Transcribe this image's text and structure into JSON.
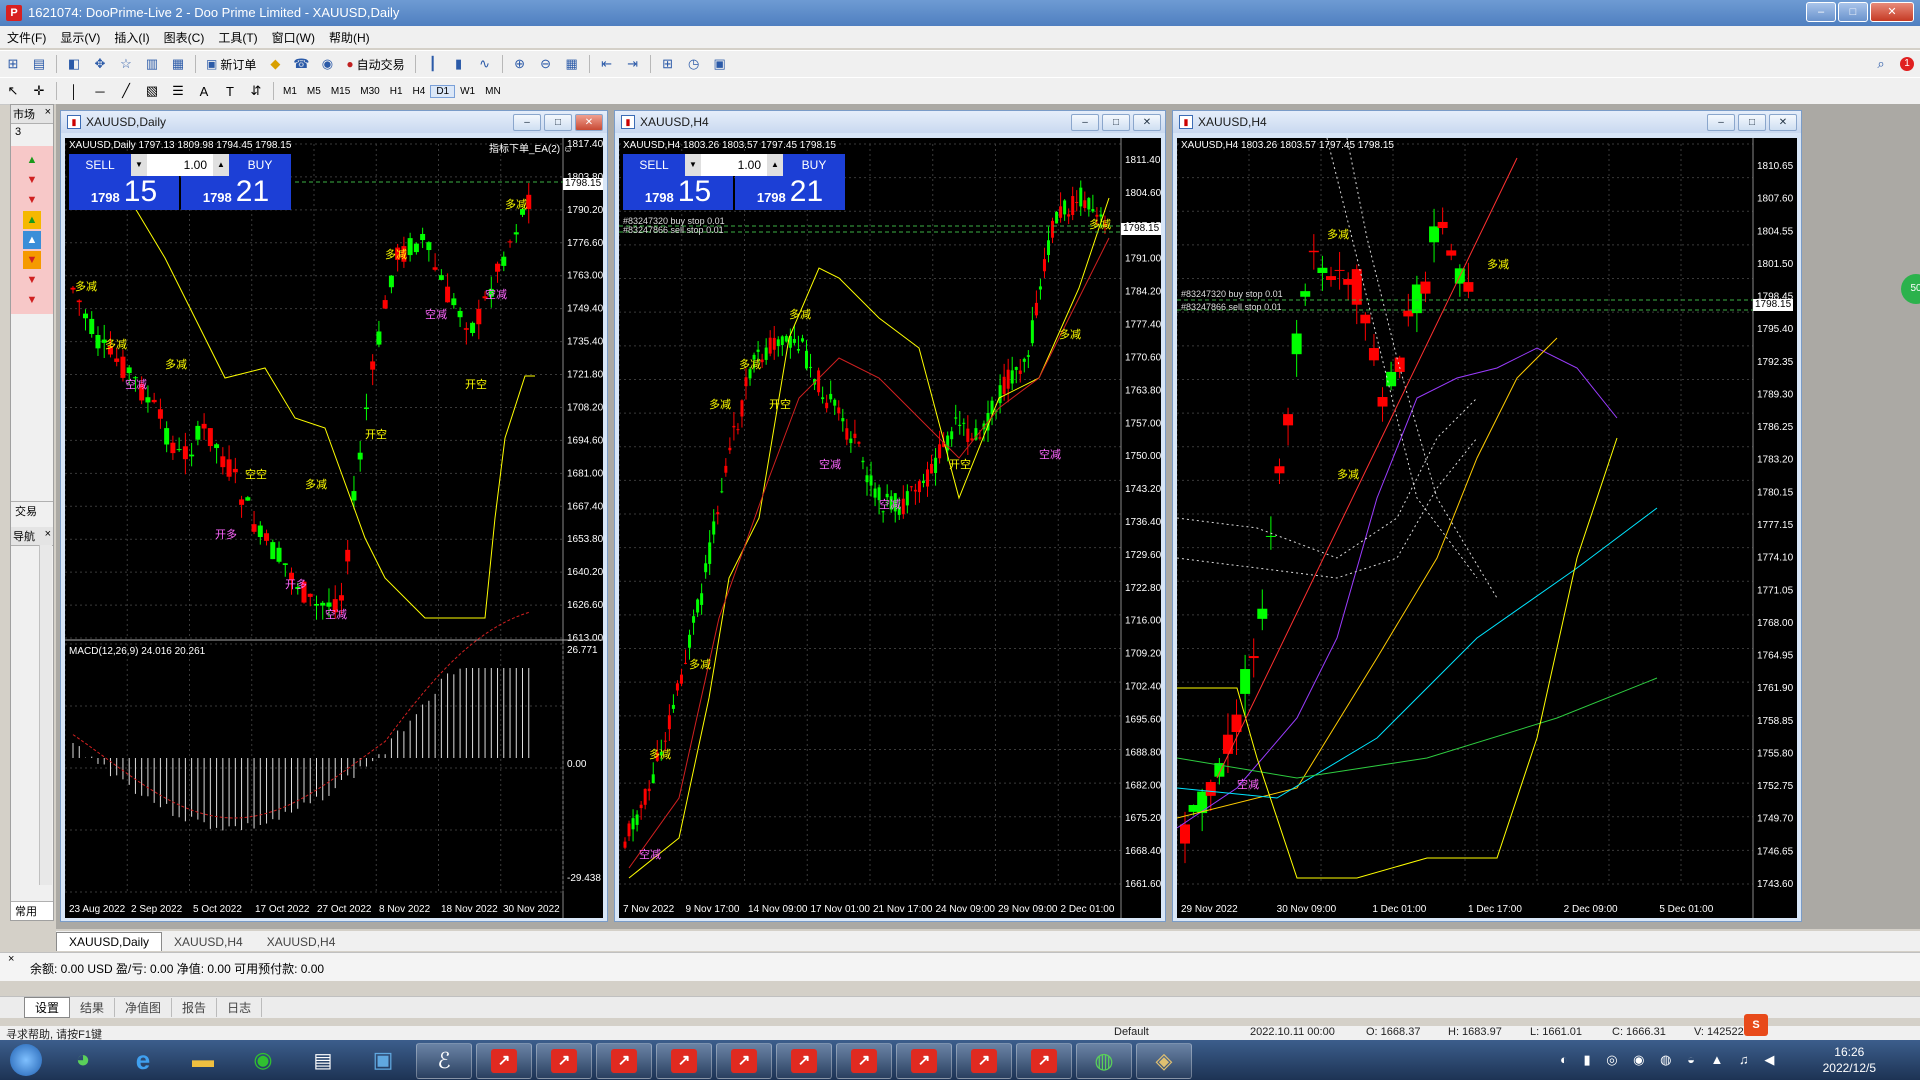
{
  "window": {
    "title": "1621074: DooPrime-Live 2 - Doo Prime Limited - XAUUSD,Daily",
    "logo": "P",
    "minimize": "–",
    "maximize": "□",
    "close": "✕"
  },
  "menu": [
    "文件(F)",
    "显示(V)",
    "插入(I)",
    "图表(C)",
    "工具(T)",
    "窗口(W)",
    "帮助(H)"
  ],
  "toolbar": {
    "new_order": "新订单",
    "auto_trade": "自动交易",
    "notification_count": "1"
  },
  "timeframes": [
    "M1",
    "M5",
    "M15",
    "M30",
    "H1",
    "H4",
    "D1",
    "W1",
    "MN"
  ],
  "active_timeframe": "D1",
  "left_panel": {
    "market_label": "市场",
    "market_value": "3",
    "trade_label": "交易",
    "nav_label": "导航",
    "common_label": "常用"
  },
  "charts": [
    {
      "window_title": "XAUUSD,Daily",
      "info": "XAUUSD,Daily  1797.13 1809.98 1794.45 1798.15",
      "ea_label": "指标下单_EA(2) ☺",
      "sell_label": "SELL",
      "buy_label": "BUY",
      "lot": "1.00",
      "bid_small": "1798",
      "bid_large": "15",
      "ask_small": "1798",
      "ask_large": "21",
      "current_price": "1798.15",
      "price_ticks": [
        "1817.40",
        "1803.80",
        "1790.20",
        "1776.60",
        "1763.00",
        "1749.40",
        "1735.40",
        "1721.80",
        "1708.20",
        "1694.60",
        "1681.00",
        "1667.40",
        "1653.80",
        "1640.20",
        "1626.60",
        "1613.00"
      ],
      "date_ticks": [
        "23 Aug 2022",
        "2 Sep 2022",
        "5 Oct 2022",
        "17 Oct 2022",
        "27 Oct 2022",
        "8 Nov 2022",
        "18 Nov 2022",
        "30 Nov 2022"
      ],
      "macd_label": "MACD(12,26,9) 24.016 20.261",
      "macd_ticks": [
        "26.771",
        "0.00",
        "-29.438"
      ]
    },
    {
      "window_title": "XAUUSD,H4",
      "info": "XAUUSD,H4  1803.26 1803.57 1797.45 1798.15",
      "sell_label": "SELL",
      "buy_label": "BUY",
      "lot": "1.00",
      "bid_small": "1798",
      "bid_large": "15",
      "ask_small": "1798",
      "ask_large": "21",
      "current_price": "1798.15",
      "order1": "#83247320 buy stop 0.01",
      "order2": "#83247866 sell stop 0.01",
      "price_ticks": [
        "1811.40",
        "1804.60",
        "1797.85",
        "1791.00",
        "1784.20",
        "1777.40",
        "1770.60",
        "1763.80",
        "1757.00",
        "1750.00",
        "1743.20",
        "1736.40",
        "1729.60",
        "1722.80",
        "1716.00",
        "1709.20",
        "1702.40",
        "1695.60",
        "1688.80",
        "1682.00",
        "1675.20",
        "1668.40",
        "1661.60"
      ],
      "date_ticks": [
        "7 Nov 2022",
        "9 Nov 17:00",
        "14 Nov 09:00",
        "17 Nov 01:00",
        "21 Nov 17:00",
        "24 Nov 09:00",
        "29 Nov 09:00",
        "2 Dec 01:00"
      ]
    },
    {
      "window_title": "XAUUSD,H4",
      "info": "XAUUSD,H4  1803.26 1803.57 1797.45 1798.15",
      "current_price": "1798.15",
      "order1": "#83247320 buy stop 0.01",
      "order2": "#83247866 sell stop 0.01",
      "price_ticks": [
        "1810.65",
        "1807.60",
        "1804.55",
        "1801.50",
        "1798.45",
        "1795.40",
        "1792.35",
        "1789.30",
        "1786.25",
        "1783.20",
        "1780.15",
        "1777.15",
        "1774.10",
        "1771.05",
        "1768.00",
        "1764.95",
        "1761.90",
        "1758.85",
        "1755.80",
        "1752.75",
        "1749.70",
        "1746.65",
        "1743.60"
      ],
      "date_ticks": [
        "29 Nov 2022",
        "30 Nov 09:00",
        "1 Dec 01:00",
        "1 Dec 17:00",
        "2 Dec 09:00",
        "5 Dec 01:00"
      ]
    }
  ],
  "chart_tabs": [
    "XAUUSD,Daily",
    "XAUUSD,H4",
    "XAUUSD,H4"
  ],
  "account": "余额: 0.00 USD  盈/亏: 0.00  净值: 0.00  可用预付款: 0.00",
  "terminal_tabs": [
    "设置",
    "结果",
    "净值图",
    "报告",
    "日志"
  ],
  "status": {
    "help": "寻求帮助, 请按F1键",
    "profile": "Default",
    "datetime": "2022.10.11 00:00",
    "open": "O: 1668.37",
    "high": "H: 1683.97",
    "low": "L: 1661.01",
    "close": "C: 1666.31",
    "volume": "V: 142522"
  },
  "taskbar": {
    "time": "16:26",
    "date": "2022/12/5"
  },
  "colors": {
    "bull": "#00ff00",
    "bear": "#ff0000",
    "indicator": "#ffff00",
    "panel_blue": "#1c3fd6"
  }
}
